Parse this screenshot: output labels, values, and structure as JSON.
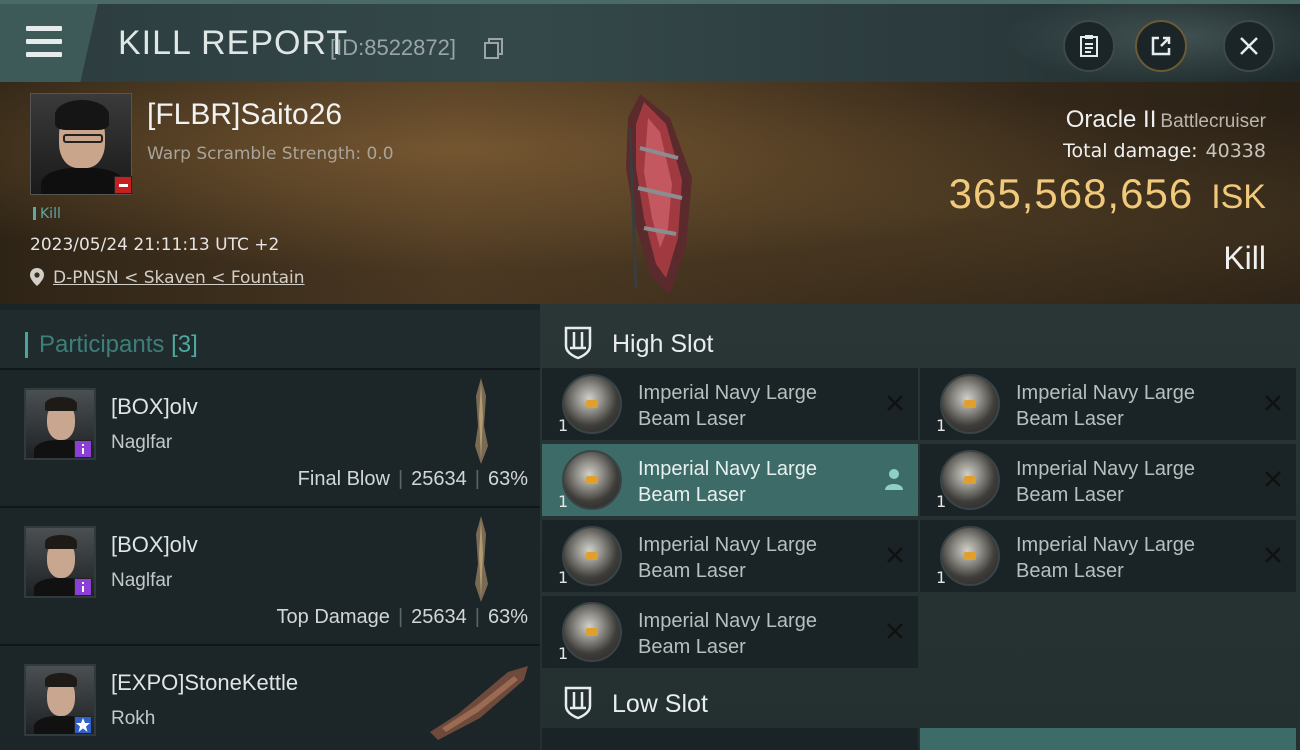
{
  "header": {
    "title": "KILL REPORT",
    "report_id": "[ID:8522872]",
    "icons": [
      "menu-icon",
      "copy-icon",
      "clipboard-icon",
      "share-icon",
      "close-icon"
    ]
  },
  "victim": {
    "name": "[FLBR]Saito26",
    "warp_scramble": "Warp Scramble Strength: 0.0",
    "tag": "Kill",
    "datetime": "2023/05/24 21:11:13 UTC +2",
    "location": "D-PNSN < Skaven < Fountain",
    "ship_name": "Oracle II",
    "ship_class": "Battlecruiser",
    "total_damage_label": "Total damage:",
    "total_damage": "40338",
    "isk_value": "365,568,656",
    "isk_unit": "ISK",
    "result": "Kill"
  },
  "participants": {
    "title": "Participants",
    "count": "[3]",
    "items": [
      {
        "name": "[BOX]olv",
        "ship": "Naglfar",
        "stats_label": "Final Blow",
        "damage": "25634",
        "percent": "63%",
        "corp_color": "#8b3fd6"
      },
      {
        "name": "[BOX]olv",
        "ship": "Naglfar",
        "stats_label": "Top Damage",
        "damage": "25634",
        "percent": "63%",
        "corp_color": "#8b3fd6"
      },
      {
        "name": "[EXPO]StoneKettle",
        "ship": "Rokh",
        "corp_color": "#2f5fc8"
      }
    ]
  },
  "fitting": {
    "high_slot_label": "High Slot",
    "low_slot_label": "Low Slot",
    "high_slot": [
      {
        "line1": "Imperial Navy Large",
        "line2": "Beam Laser",
        "qty": "1",
        "state": "destroyed"
      },
      {
        "line1": "Imperial Navy Large",
        "line2": "Beam Laser",
        "qty": "1",
        "state": "destroyed"
      },
      {
        "line1": "Imperial Navy Large",
        "line2": "Beam Laser",
        "qty": "1",
        "state": "dropped"
      },
      {
        "line1": "Imperial Navy Large",
        "line2": "Beam Laser",
        "qty": "1",
        "state": "destroyed"
      },
      {
        "line1": "Imperial Navy Large",
        "line2": "Beam Laser",
        "qty": "1",
        "state": "destroyed"
      },
      {
        "line1": "Imperial Navy Large",
        "line2": "Beam Laser",
        "qty": "1",
        "state": "destroyed"
      },
      {
        "line1": "Imperial Navy Large",
        "line2": "Beam Laser",
        "qty": "1",
        "state": "destroyed"
      }
    ]
  },
  "colors": {
    "accent_teal": "#4aa69c",
    "isk_gold": "#f1c97a",
    "selected_row": "#3d6c68",
    "loss_badge": "#c42020"
  }
}
